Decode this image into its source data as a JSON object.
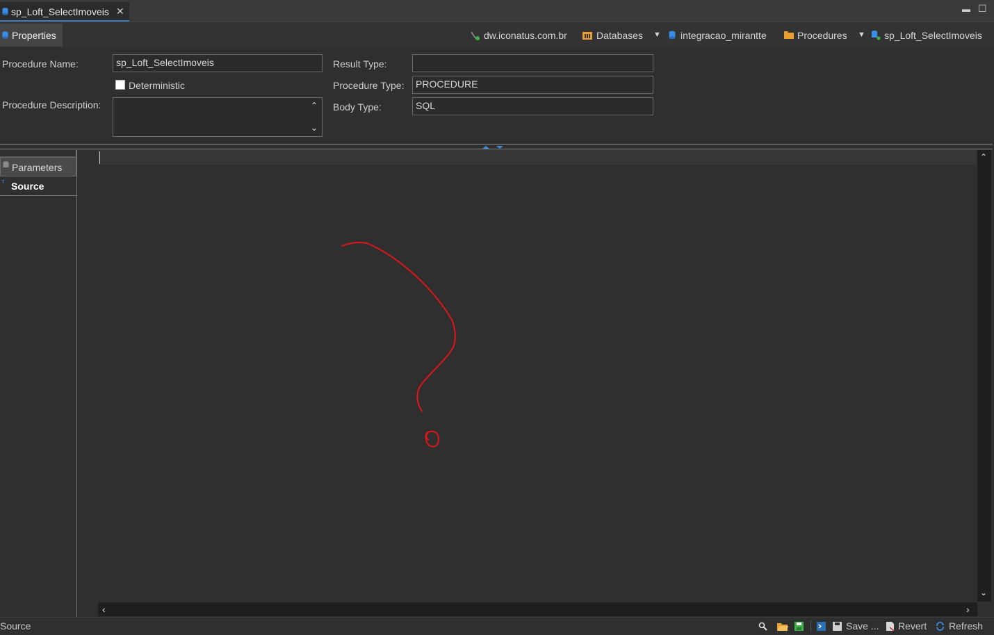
{
  "editor_tab": {
    "title": "sp_Loft_SelectImoveis",
    "close": "✕"
  },
  "window_controls": {
    "minimize": "▬",
    "maximize": "☐"
  },
  "properties_tab": {
    "label": "Properties"
  },
  "breadcrumb": [
    {
      "label": "dw.iconatus.com.br",
      "icon": "server-icon"
    },
    {
      "label": "Databases",
      "icon": "databases-icon"
    },
    {
      "label": "integracao_mirantte",
      "icon": "database-icon"
    },
    {
      "label": "Procedures",
      "icon": "folder-icon"
    },
    {
      "label": "sp_Loft_SelectImoveis",
      "icon": "procedure-icon"
    }
  ],
  "form": {
    "procedure_name_label": "Procedure Name:",
    "procedure_name_value": "sp_Loft_SelectImoveis",
    "deterministic_label": "Deterministic",
    "procedure_description_label": "Procedure Description:",
    "result_type_label": "Result Type:",
    "result_type_value": "",
    "procedure_type_label": "Procedure Type:",
    "procedure_type_value": "PROCEDURE",
    "body_type_label": "Body Type:",
    "body_type_value": "SQL"
  },
  "side_tabs": [
    {
      "label": "Parameters"
    },
    {
      "label": "Source"
    }
  ],
  "statusbar": {
    "left_label": "Source",
    "save_label": "Save ...",
    "revert_label": "Revert",
    "refresh_label": "Refresh"
  },
  "colors": {
    "accent": "#3d7bbf",
    "annotation": "#e0161b",
    "folder": "#e8a030"
  }
}
